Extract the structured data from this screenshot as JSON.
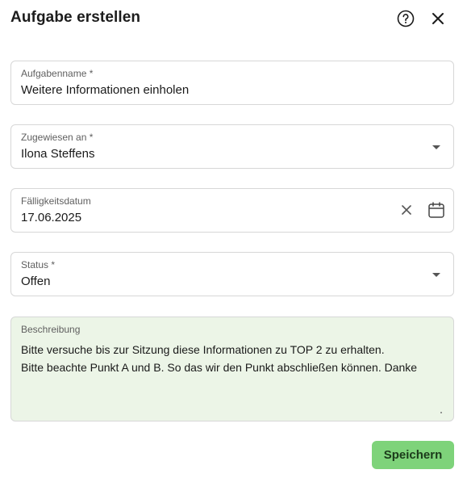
{
  "dialog": {
    "title": "Aufgabe erstellen",
    "help_icon": "question-circle-icon",
    "close_icon": "close-x-icon"
  },
  "fields": {
    "task_name": {
      "label": "Aufgabenname *",
      "value": "Weitere Informationen einholen"
    },
    "assignee": {
      "label": "Zugewiesen an *",
      "value": "Ilona Steffens",
      "icon": "chevron-down-icon"
    },
    "due_date": {
      "label": "Fälligkeitsdatum",
      "value": "17.06.2025",
      "clear_icon": "clear-x-icon",
      "calendar_icon": "calendar-icon"
    },
    "status": {
      "label": "Status *",
      "value": "Offen",
      "icon": "chevron-down-icon"
    },
    "description": {
      "label": "Beschreibung",
      "value": "Bitte versuche bis zur Sitzung diese Informationen zu TOP 2 zu erhalten.\nBitte beachte Punkt A und B.  So das wir den Punkt abschließen können. Danke",
      "background": "#ecf5e7"
    }
  },
  "actions": {
    "save_label": "Speichern",
    "save_color": "#7ed37a"
  }
}
